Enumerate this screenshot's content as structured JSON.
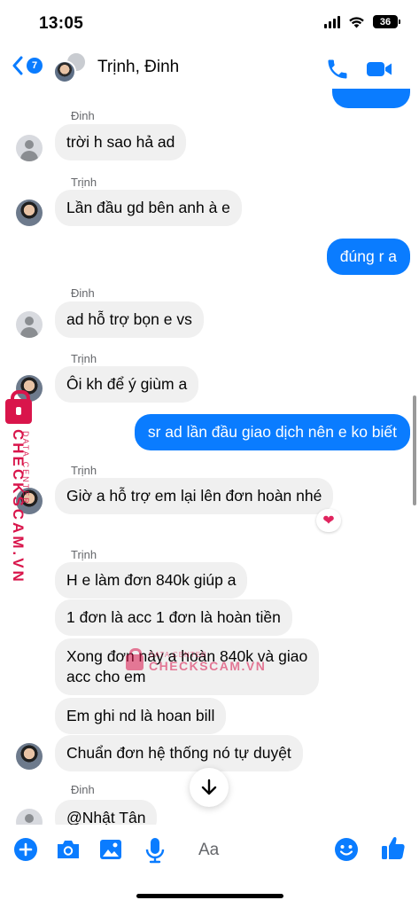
{
  "status_bar": {
    "time": "13:05",
    "battery": "36"
  },
  "header": {
    "back_badge": "7",
    "title": "Trịnh, Đinh"
  },
  "messages": [
    {
      "sender": "Đinh",
      "text": "trời h sao hả ad"
    },
    {
      "sender": "Trịnh",
      "text": "Lần đầu gd bên anh à e"
    },
    {
      "text": "đúng r a"
    },
    {
      "sender": "Đinh",
      "text": "ad hỗ trợ bọn e vs"
    },
    {
      "sender": "Trịnh",
      "text": "Ôi kh để ý giùm a"
    },
    {
      "text": "sr ad lần đầu giao dịch nên e ko biết"
    },
    {
      "sender": "Trịnh",
      "text": "Giờ a hỗ trợ em lại lên đơn hoàn nhé",
      "reaction": "❤"
    },
    {
      "sender": "Trịnh",
      "text": "H e làm đơn 840k giúp a"
    },
    {
      "text": "1 đơn là acc 1 đơn là hoàn tiền"
    },
    {
      "text": "Xong đơn này a hoàn 840k và giao\nacc cho em"
    },
    {
      "text": "Em ghi nd là hoan bill"
    },
    {
      "text": "Chuẩn đơn hệ thống nó tự duyệt"
    },
    {
      "sender": "Đinh",
      "text": "@Nhật Tân"
    }
  ],
  "watermark": {
    "main": "CHECKSCAM.VN",
    "sub": "DATA CENTER",
    "center_main": "CHECKSCAM.VN",
    "center_sub": "DATA CENTER"
  },
  "composer": {
    "placeholder": "Aa"
  },
  "colors": {
    "accent": "#0a7cff",
    "incoming_bubble": "#f0f0f0",
    "watermark": "#d9154b"
  }
}
